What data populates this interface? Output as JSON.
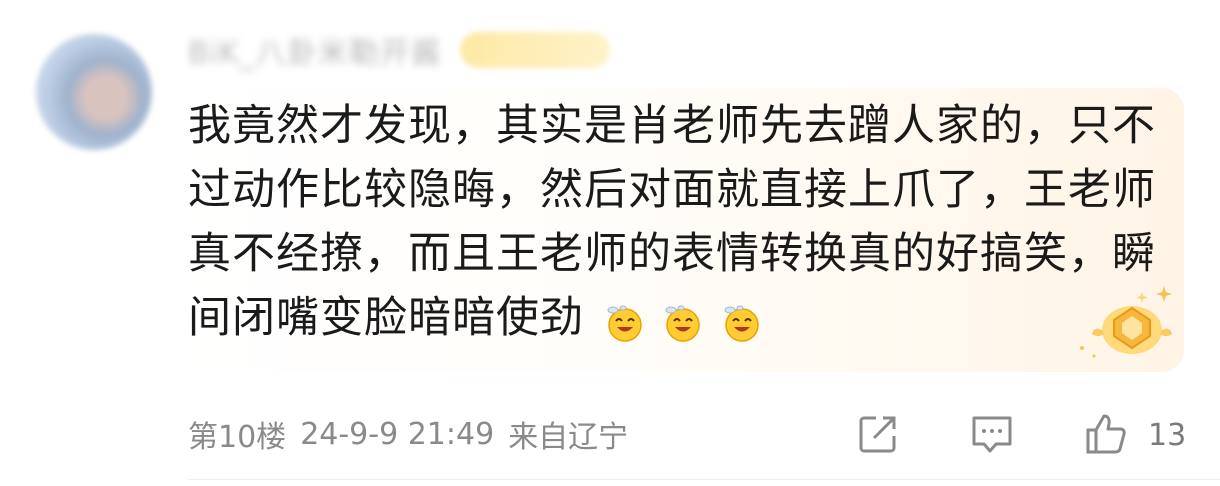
{
  "comment": {
    "username": "BiK_八卦米勒开酱",
    "text": "我竟然才发现，其实是肖老师先去蹭人家的，只不过动作比较隐晦，然后对面就直接上爪了，王老师真不经撩，而且王老师的表情转换真的好搞笑，瞬间闭嘴变脸暗暗使劲",
    "emoji_names": [
      "sweat-grin-emoji",
      "sweat-grin-emoji",
      "sweat-grin-emoji"
    ],
    "floor": "第10楼",
    "datetime": "24-9-9 21:49",
    "location": "来自辽宁",
    "like_count": "13"
  },
  "colors": {
    "text": "#1a1a1a",
    "meta": "#8a8a8a",
    "badge_gold": "#f6b73c",
    "bubble_tint": "#fff4e6"
  },
  "icons": {
    "share": "share-icon",
    "reply": "comment-icon",
    "like": "thumbs-up-icon",
    "vip": "vip-badge-icon"
  }
}
